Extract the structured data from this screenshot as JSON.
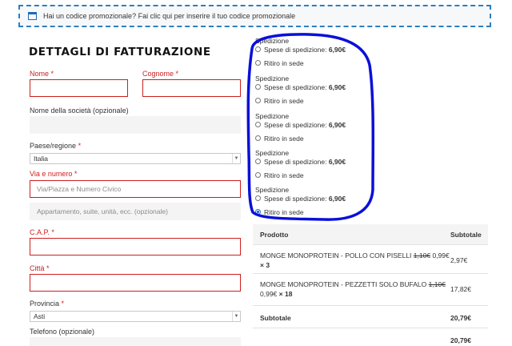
{
  "notice": {
    "icon": "window-icon",
    "text_prefix": "Hai un codice promozionale?",
    "link": "Fai clic qui per inserire il tuo codice promozionale"
  },
  "billing": {
    "title": "DETTAGLI DI FATTURAZIONE",
    "required_mark": "*",
    "first_name": {
      "label": "Nome",
      "value": ""
    },
    "last_name": {
      "label": "Cognome",
      "value": ""
    },
    "company": {
      "label": "Nome della società (opzionale)",
      "value": ""
    },
    "country": {
      "label": "Paese/regione",
      "value": "Italia"
    },
    "street": {
      "label": "Via e numero",
      "placeholder": "Via/Piazza e Numero Civico"
    },
    "street2": {
      "placeholder": "Appartamento, suite, unità, ecc. (opzionale)"
    },
    "zip": {
      "label": "C.A.P.",
      "value": ""
    },
    "city": {
      "label": "Città",
      "value": ""
    },
    "province": {
      "label": "Provincia",
      "value": "Asti"
    },
    "phone": {
      "label": "Telefono (opzionale)"
    }
  },
  "shipping": {
    "blocks": [
      {
        "title": "Spedizione",
        "cost_label": "Spese di spedizione:",
        "cost": "6,90€",
        "pickup": "Ritiro in sede",
        "selected": "none"
      },
      {
        "title": "Spedizione",
        "cost_label": "Spese di spedizione:",
        "cost": "6,90€",
        "pickup": "Ritiro in sede",
        "selected": "none"
      },
      {
        "title": "Spedizione",
        "cost_label": "Spese di spedizione:",
        "cost": "6,90€",
        "pickup": "Ritiro in sede",
        "selected": "none"
      },
      {
        "title": "Spedizione",
        "cost_label": "Spese di spedizione:",
        "cost": "6,90€",
        "pickup": "Ritiro in sede",
        "selected": "none"
      },
      {
        "title": "Spedizione",
        "cost_label": "Spese di spedizione:",
        "cost": "6,90€",
        "pickup": "Ritiro in sede",
        "selected": "pickup"
      }
    ]
  },
  "order": {
    "col_product": "Prodotto",
    "col_subtotal": "Subtotale",
    "items": [
      {
        "name": "MONGE MONOPROTEIN - POLLO CON PISELLI",
        "old_price": "1,10€",
        "price": "0,99€",
        "qty": "× 3",
        "subtotal": "2,97€"
      },
      {
        "name": "MONGE MONOPROTEIN - PEZZETTI SOLO BUFALO",
        "old_price": "1,10€",
        "price": "0,99€",
        "qty": "× 18",
        "subtotal": "17,82€"
      }
    ],
    "subtotal_label": "Subtotale",
    "subtotal_value": "20,79€",
    "total_value": "20,79€"
  },
  "colors": {
    "accent_blue": "#1a66d8",
    "annotation": "#0a10d8",
    "error_red": "#cc1f1f",
    "notice_border": "#2d7fc1"
  }
}
